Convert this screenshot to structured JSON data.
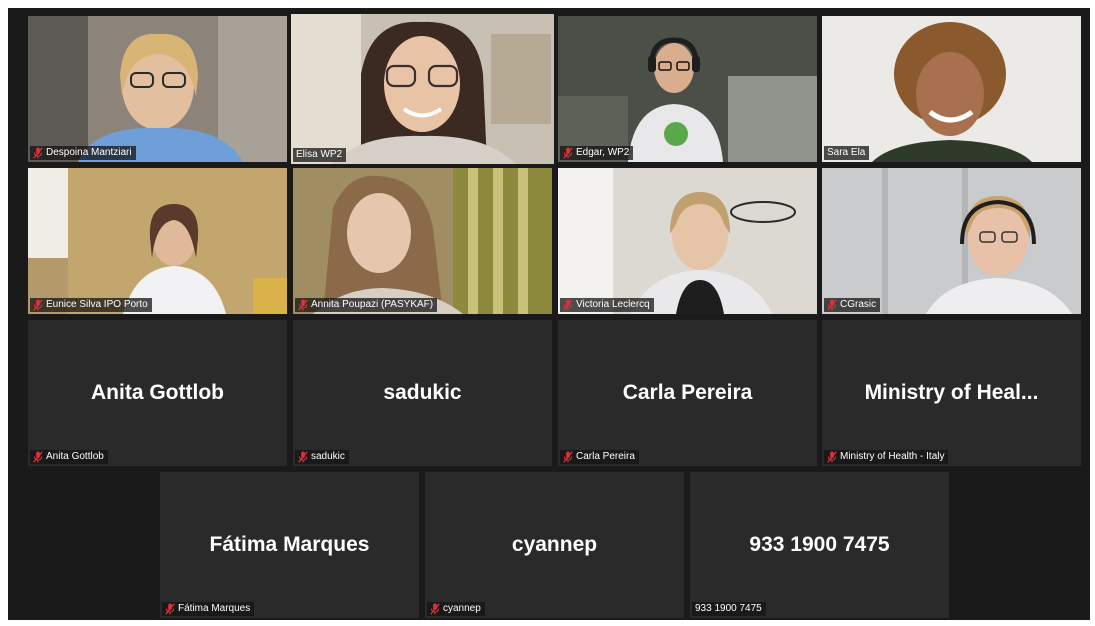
{
  "colors": {
    "gallery_bg": "#1a1a1a",
    "tile_bg": "#2a2a2a",
    "active_border": "#c9e27a",
    "muted_icon": "#e0303a"
  },
  "participants": {
    "row1": [
      {
        "label": "Despoina Mantziari",
        "muted": true
      },
      {
        "label": "Elisa WP2",
        "muted": false,
        "active": true
      },
      {
        "label": "Edgar, WP2",
        "muted": true
      },
      {
        "label": "Sara Ela",
        "muted": false
      }
    ],
    "row2": [
      {
        "label": "Eunice Silva IPO Porto",
        "muted": true
      },
      {
        "label": "Annita Poupazi (PASYKAF)",
        "muted": true
      },
      {
        "label": "Victoria Leclercq",
        "muted": true
      },
      {
        "label": "CGrasic",
        "muted": true
      }
    ],
    "row3": [
      {
        "display": "Anita Gottlob",
        "label": "Anita Gottlob",
        "muted": true
      },
      {
        "display": "sadukic",
        "label": "sadukic",
        "muted": true
      },
      {
        "display": "Carla Pereira",
        "label": "Carla Pereira",
        "muted": true
      },
      {
        "display": "Ministry of Heal...",
        "label": "Ministry of Health - Italy",
        "muted": true
      }
    ],
    "row4": [
      {
        "display": "Fátima Marques",
        "label": "Fátima Marques",
        "muted": true
      },
      {
        "display": "cyannep",
        "label": "cyannep",
        "muted": true
      },
      {
        "display": "933 1900 7475",
        "label": "933 1900 7475",
        "muted": false
      }
    ]
  }
}
